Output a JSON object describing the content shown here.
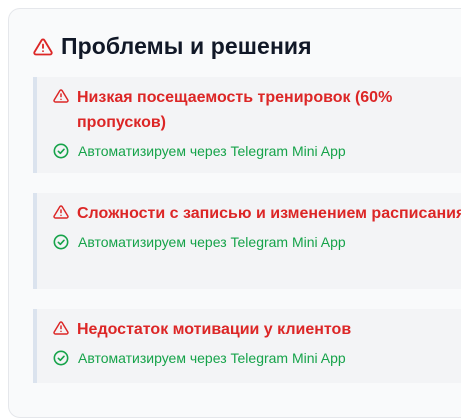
{
  "card": {
    "title": "Проблемы и решения",
    "icon": "warning-triangle-icon",
    "accent_color": "#dc2626",
    "success_color": "#16a34a"
  },
  "problems": [
    {
      "title": "Низкая посещаемость тренировок (60% пропусков)",
      "solution": "Автоматизируем через Telegram Mini App"
    },
    {
      "title": "Сложности с записью и изменением расписания",
      "solution": "Автоматизируем через Telegram Mini App"
    },
    {
      "title": "Недостаток мотивации у клиентов",
      "solution": "Автоматизируем через Telegram Mini App"
    }
  ]
}
